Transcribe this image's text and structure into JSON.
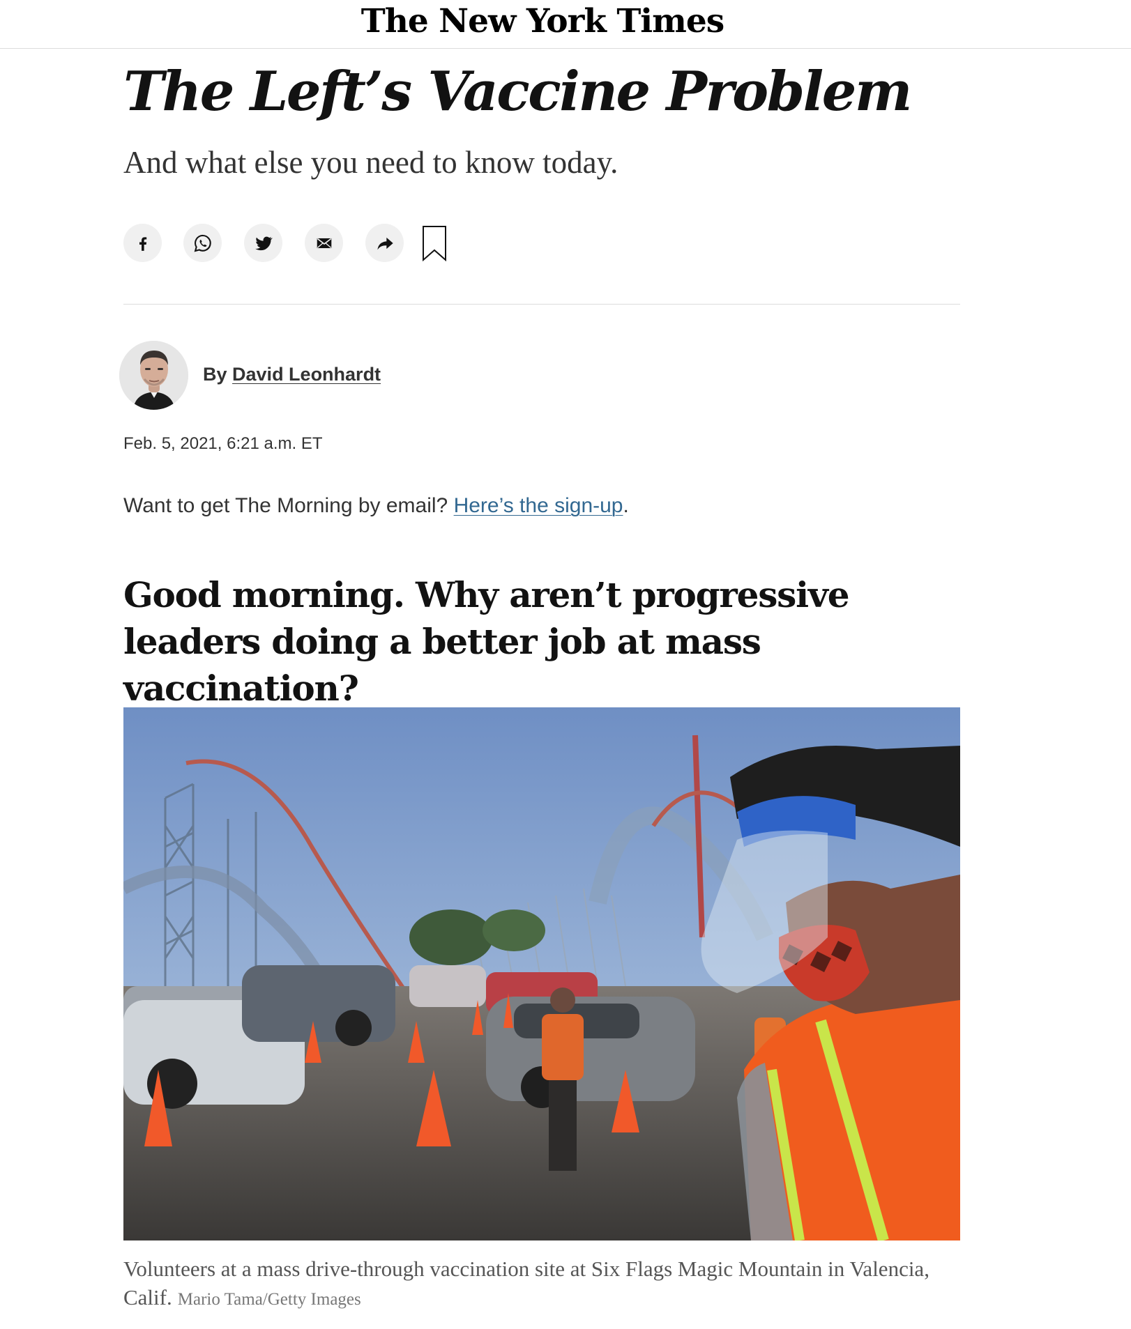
{
  "masthead": {
    "logo_text": "The New York Times"
  },
  "article": {
    "headline": "The Left’s Vaccine Problem",
    "summary": "And what else you need to know today.",
    "share": {
      "facebook": "facebook-icon",
      "whatsapp": "whatsapp-icon",
      "twitter": "twitter-icon",
      "email": "email-icon",
      "more": "share-arrow-icon",
      "save": "bookmark-icon"
    },
    "byline": {
      "prefix": "By",
      "author": "David Leonhardt"
    },
    "dateline": "Feb. 5, 2021, 6:21 a.m. ET",
    "signup": {
      "text": "Want to get The Morning by email?",
      "link_text": "Here’s the sign-up",
      "trailing": "."
    },
    "lede": "Good morning. Why aren’t progressive leaders doing a better job at mass vaccination?",
    "photo": {
      "caption": "Volunteers at a mass drive-through vaccination site at Six Flags Magic Mountain in Valencia, Calif.",
      "credit": "Mario Tama/Getty Images"
    }
  },
  "colors": {
    "link": "#326891",
    "text": "#121212",
    "share_button_bg": "#f0f0f0"
  }
}
